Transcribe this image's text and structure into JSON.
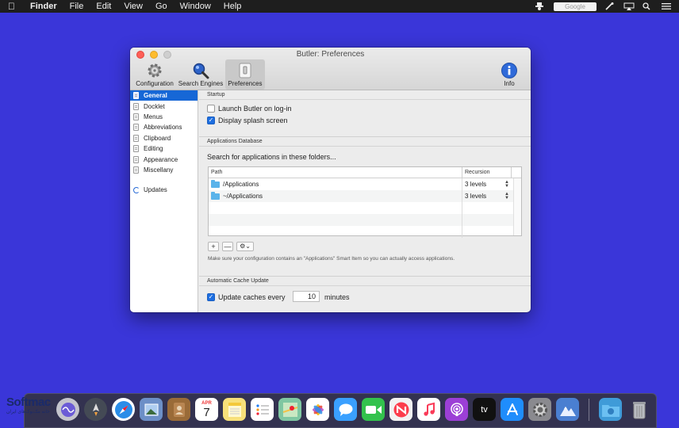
{
  "menubar": {
    "app": "Finder",
    "items": [
      "File",
      "Edit",
      "View",
      "Go",
      "Window",
      "Help"
    ],
    "search_placeholder": "Google"
  },
  "window": {
    "title": "Butler: Preferences",
    "toolbar": [
      {
        "label": "Configuration",
        "icon": "gear-icon"
      },
      {
        "label": "Search Engines",
        "icon": "magnifier-icon"
      },
      {
        "label": "Preferences",
        "icon": "switch-icon",
        "active": true
      },
      {
        "label": "Info",
        "icon": "info-icon"
      }
    ]
  },
  "sidebar": {
    "items": [
      "General",
      "Docklet",
      "Menus",
      "Abbreviations",
      "Clipboard",
      "Editing",
      "Appearance",
      "Miscellany"
    ],
    "selected": "General",
    "extra": "Updates"
  },
  "startup": {
    "header": "Startup",
    "launch_on_login": {
      "label": "Launch Butler on log-in",
      "checked": false
    },
    "splash": {
      "label": "Display splash screen",
      "checked": true
    }
  },
  "appdb": {
    "header": "Applications Database",
    "prompt": "Search for applications in these folders...",
    "columns": {
      "path": "Path",
      "recursion": "Recursion"
    },
    "rows": [
      {
        "path": "/Applications",
        "recursion": "3 levels"
      },
      {
        "path": "~/Applications",
        "recursion": "3 levels"
      }
    ],
    "buttons": {
      "add": "+",
      "remove": "—",
      "action": "⚙⌄"
    },
    "note": "Make sure your configuration contains an \"Applications\" Smart Item so you can actually access applications."
  },
  "cache": {
    "header": "Automatic Cache Update",
    "label": "Update caches every",
    "value": "10",
    "unit": "minutes",
    "checked": true
  },
  "dock": {
    "calendar_day": "7",
    "calendar_month": "APR",
    "tv_label": "tv"
  },
  "watermark": {
    "brand": "Softmac",
    "subtitle": "خانه مک‌بوک‌های ایران"
  },
  "colors": {
    "desktop": "#3a36d9",
    "selection": "#1667d6",
    "checkbox": "#1d6ee0"
  }
}
